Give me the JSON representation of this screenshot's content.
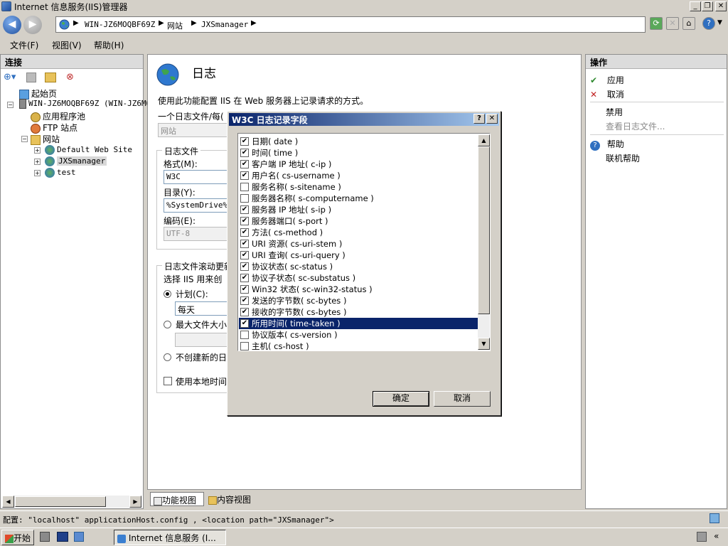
{
  "window": {
    "title": "Internet 信息服务(IIS)管理器",
    "controls": {
      "minimize": "_",
      "restore": "❐",
      "close": "✕"
    }
  },
  "address": {
    "crumbs": [
      "WIN-JZ6MOQBF69Z",
      "网站",
      "JXSmanager"
    ]
  },
  "menu": [
    "文件(F)",
    "视图(V)",
    "帮助(H)"
  ],
  "connections": {
    "header": "连接",
    "tree": {
      "start": "起始页",
      "server": "WIN-JZ6MOQBF69Z (WIN-JZ6MO",
      "app_pools": "应用程序池",
      "ftp": "FTP 站点",
      "sites": "网站",
      "site1": "Default Web Site",
      "site2": "JXSmanager",
      "site3": "test"
    }
  },
  "main": {
    "title": "日志",
    "description": "使用此功能配置 IIS 在 Web 服务器上记录请求的方式。",
    "one_log_label": "一个日志文件/每(",
    "one_log_value": "网站",
    "logfile_group": "日志文件",
    "format_label": "格式(M):",
    "format_value": "W3C",
    "directory_label": "目录(Y):",
    "directory_value": "%SystemDrive%\\i",
    "encoding_label": "编码(E):",
    "encoding_value": "UTF-8",
    "rollover_group": "日志文件滚动更新",
    "rollover_desc": "选择 IIS 用来创",
    "schedule_label": "计划(C):",
    "schedule_value": "每天",
    "maxsize_label": "最大文件大小",
    "nocreate_label": "不创建新的日",
    "localtime_label": "使用本地时间"
  },
  "view_tabs": {
    "features": "功能视图",
    "content": "内容视图"
  },
  "actions": {
    "header": "操作",
    "apply": "应用",
    "cancel": "取消",
    "disable": "禁用",
    "view_logs": "查看日志文件...",
    "help": "帮助",
    "online_help": "联机帮助"
  },
  "status": {
    "text": "配置: \"localhost\" applicationHost.config , <location path=\"JXSmanager\">"
  },
  "taskbar": {
    "start": "开始",
    "task": "Internet 信息服务 (I..."
  },
  "dialog": {
    "title": "W3C 日志记录字段",
    "help_btn": "?",
    "close_btn": "✕",
    "ok": "确定",
    "cancel": "取消",
    "fields": [
      {
        "label": "日期( date )",
        "checked": true
      },
      {
        "label": "时间( time )",
        "checked": true
      },
      {
        "label": "客户端 IP 地址( c-ip )",
        "checked": true
      },
      {
        "label": "用户名( cs-username )",
        "checked": true
      },
      {
        "label": "服务名称( s-sitename )",
        "checked": false
      },
      {
        "label": "服务器名称( s-computername )",
        "checked": false
      },
      {
        "label": "服务器 IP 地址( s-ip )",
        "checked": true
      },
      {
        "label": "服务器端口( s-port )",
        "checked": true
      },
      {
        "label": "方法( cs-method )",
        "checked": true
      },
      {
        "label": "URI 资源( cs-uri-stem )",
        "checked": true
      },
      {
        "label": "URI 查询( cs-uri-query )",
        "checked": true
      },
      {
        "label": "协议状态( sc-status )",
        "checked": true
      },
      {
        "label": "协议子状态( sc-substatus )",
        "checked": true
      },
      {
        "label": "Win32 状态( sc-win32-status )",
        "checked": true
      },
      {
        "label": "发送的字节数( sc-bytes )",
        "checked": true
      },
      {
        "label": "接收的字节数( cs-bytes )",
        "checked": true
      },
      {
        "label": "所用时间( time-taken )",
        "checked": true,
        "selected": true
      },
      {
        "label": "协议版本( cs-version )",
        "checked": false
      },
      {
        "label": "主机( cs-host )",
        "checked": false
      }
    ]
  }
}
